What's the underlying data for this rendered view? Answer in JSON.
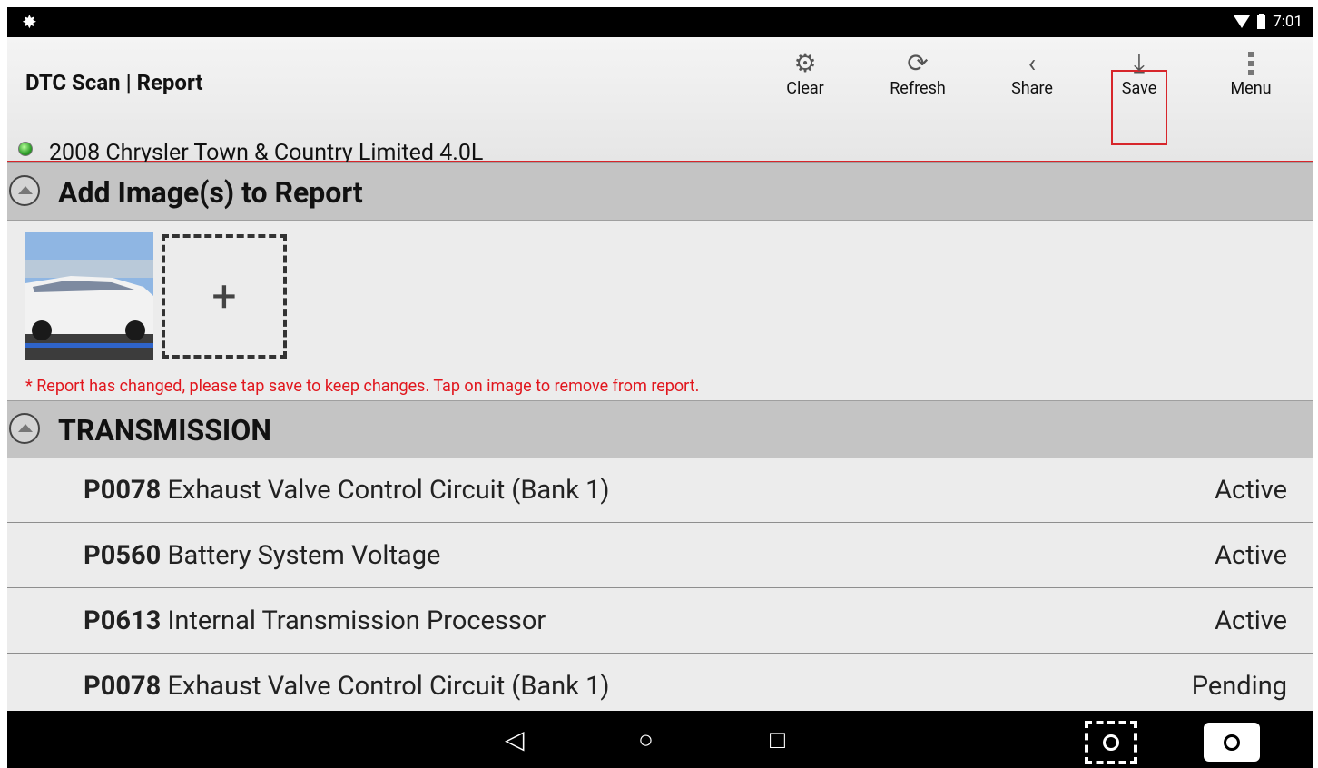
{
  "status": {
    "time": "7:01"
  },
  "header": {
    "title": "DTC Scan | Report",
    "vehicle": "2008 Chrysler Town & Country Limited 4.0L",
    "actions": {
      "clear": "Clear",
      "refresh": "Refresh",
      "share": "Share",
      "save": "Save",
      "menu": "Menu"
    }
  },
  "images_section": {
    "title": "Add Image(s) to Report",
    "notice": "* Report has changed, please tap save to keep changes. Tap on image to remove from report."
  },
  "transmission_section": {
    "title": "TRANSMISSION",
    "codes": [
      {
        "code": "P0078",
        "description": "Exhaust Valve Control Circuit (Bank 1)",
        "status": "Active"
      },
      {
        "code": "P0560",
        "description": "Battery System Voltage",
        "status": "Active"
      },
      {
        "code": "P0613",
        "description": "Internal Transmission Processor",
        "status": "Active"
      },
      {
        "code": "P0078",
        "description": "Exhaust Valve Control Circuit (Bank 1)",
        "status": "Pending"
      }
    ]
  },
  "colors": {
    "accent": "#d7262b",
    "notice": "#e1161d",
    "section_bg": "#c4c4c4"
  }
}
